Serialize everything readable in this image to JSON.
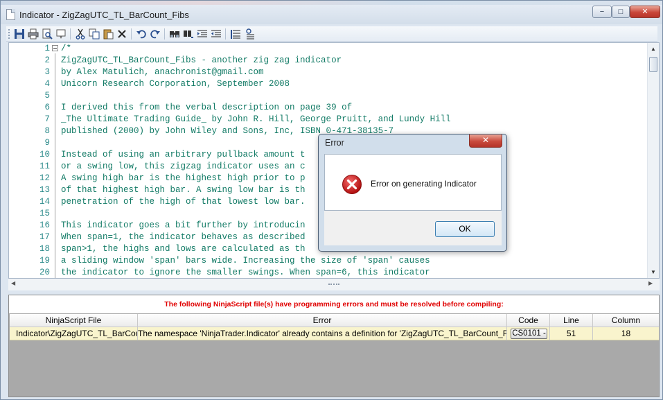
{
  "window": {
    "title": "Indicator - ZigZagUTC_TL_BarCount_Fibs",
    "minimize": "−",
    "maximize": "□",
    "close": "✕"
  },
  "toolbar": {
    "buttons": [
      "save-icon",
      "print-icon",
      "print-preview-icon",
      "properties-icon",
      "cut-icon",
      "copy-icon",
      "paste-icon",
      "delete-icon",
      "undo-icon",
      "redo-icon",
      "find-icon",
      "replace-icon",
      "indent-icon",
      "outdent-icon",
      "comment-icon",
      "uncomment-icon"
    ]
  },
  "editor": {
    "lines": [
      {
        "n": "1",
        "text": "/*"
      },
      {
        "n": "2",
        "text": "ZigZagUTC_TL_BarCount_Fibs - another zig zag indicator"
      },
      {
        "n": "3",
        "text": "by Alex Matulich, anachronist@gmail.com"
      },
      {
        "n": "4",
        "text": "Unicorn Research Corporation, September 2008"
      },
      {
        "n": "5",
        "text": ""
      },
      {
        "n": "6",
        "text": "I derived this from the verbal description on page 39 of"
      },
      {
        "n": "7",
        "text": "_The Ultimate Trading Guide_ by John R. Hill, George Pruitt, and Lundy Hill"
      },
      {
        "n": "8",
        "text": "published (2000) by John Wiley and Sons, Inc, ISBN 0-471-38135-7"
      },
      {
        "n": "9",
        "text": ""
      },
      {
        "n": "10",
        "text": "Instead of using an arbitrary pullback amount t"
      },
      {
        "n": "11",
        "text": "or a swing low, this zigzag indicator uses an c"
      },
      {
        "n": "12",
        "text": "A swing high bar is the highest high prior to p"
      },
      {
        "n": "13",
        "text": "of that highest high bar. A swing low bar is th"
      },
      {
        "n": "14",
        "text": "penetration of the high of that lowest low bar."
      },
      {
        "n": "15",
        "text": ""
      },
      {
        "n": "16",
        "text": "This indicator goes a bit further by introducin"
      },
      {
        "n": "17",
        "text": "When span=1, the indicator behaves as described"
      },
      {
        "n": "18",
        "text": "span>1, the highs and lows are calculated as th"
      },
      {
        "n": "19",
        "text": "a sliding window 'span' bars wide. Increasing the size of 'span' causes"
      },
      {
        "n": "20",
        "text": "the indicator to ignore the smaller swings. When span=6, this indicator"
      }
    ]
  },
  "errors": {
    "header": "The following NinjaScript file(s) have programming errors and must be resolved before compiling:",
    "columns": [
      "NinjaScript File",
      "Error",
      "Code",
      "Line",
      "Column"
    ],
    "rows": [
      {
        "file": "Indicator\\ZigZagUTC_TL_BarCou",
        "error": "The namespace 'NinjaTrader.Indicator' already contains a definition for 'ZigZagUTC_TL_BarCount_Fibs'",
        "code": "CS0101 -",
        "line": "51",
        "column": "18"
      }
    ]
  },
  "dialog": {
    "title": "Error",
    "message": "Error on generating Indicator",
    "ok_label": "OK",
    "close": "✕",
    "icon": "error-icon",
    "icon_color": "#d61f1f"
  }
}
